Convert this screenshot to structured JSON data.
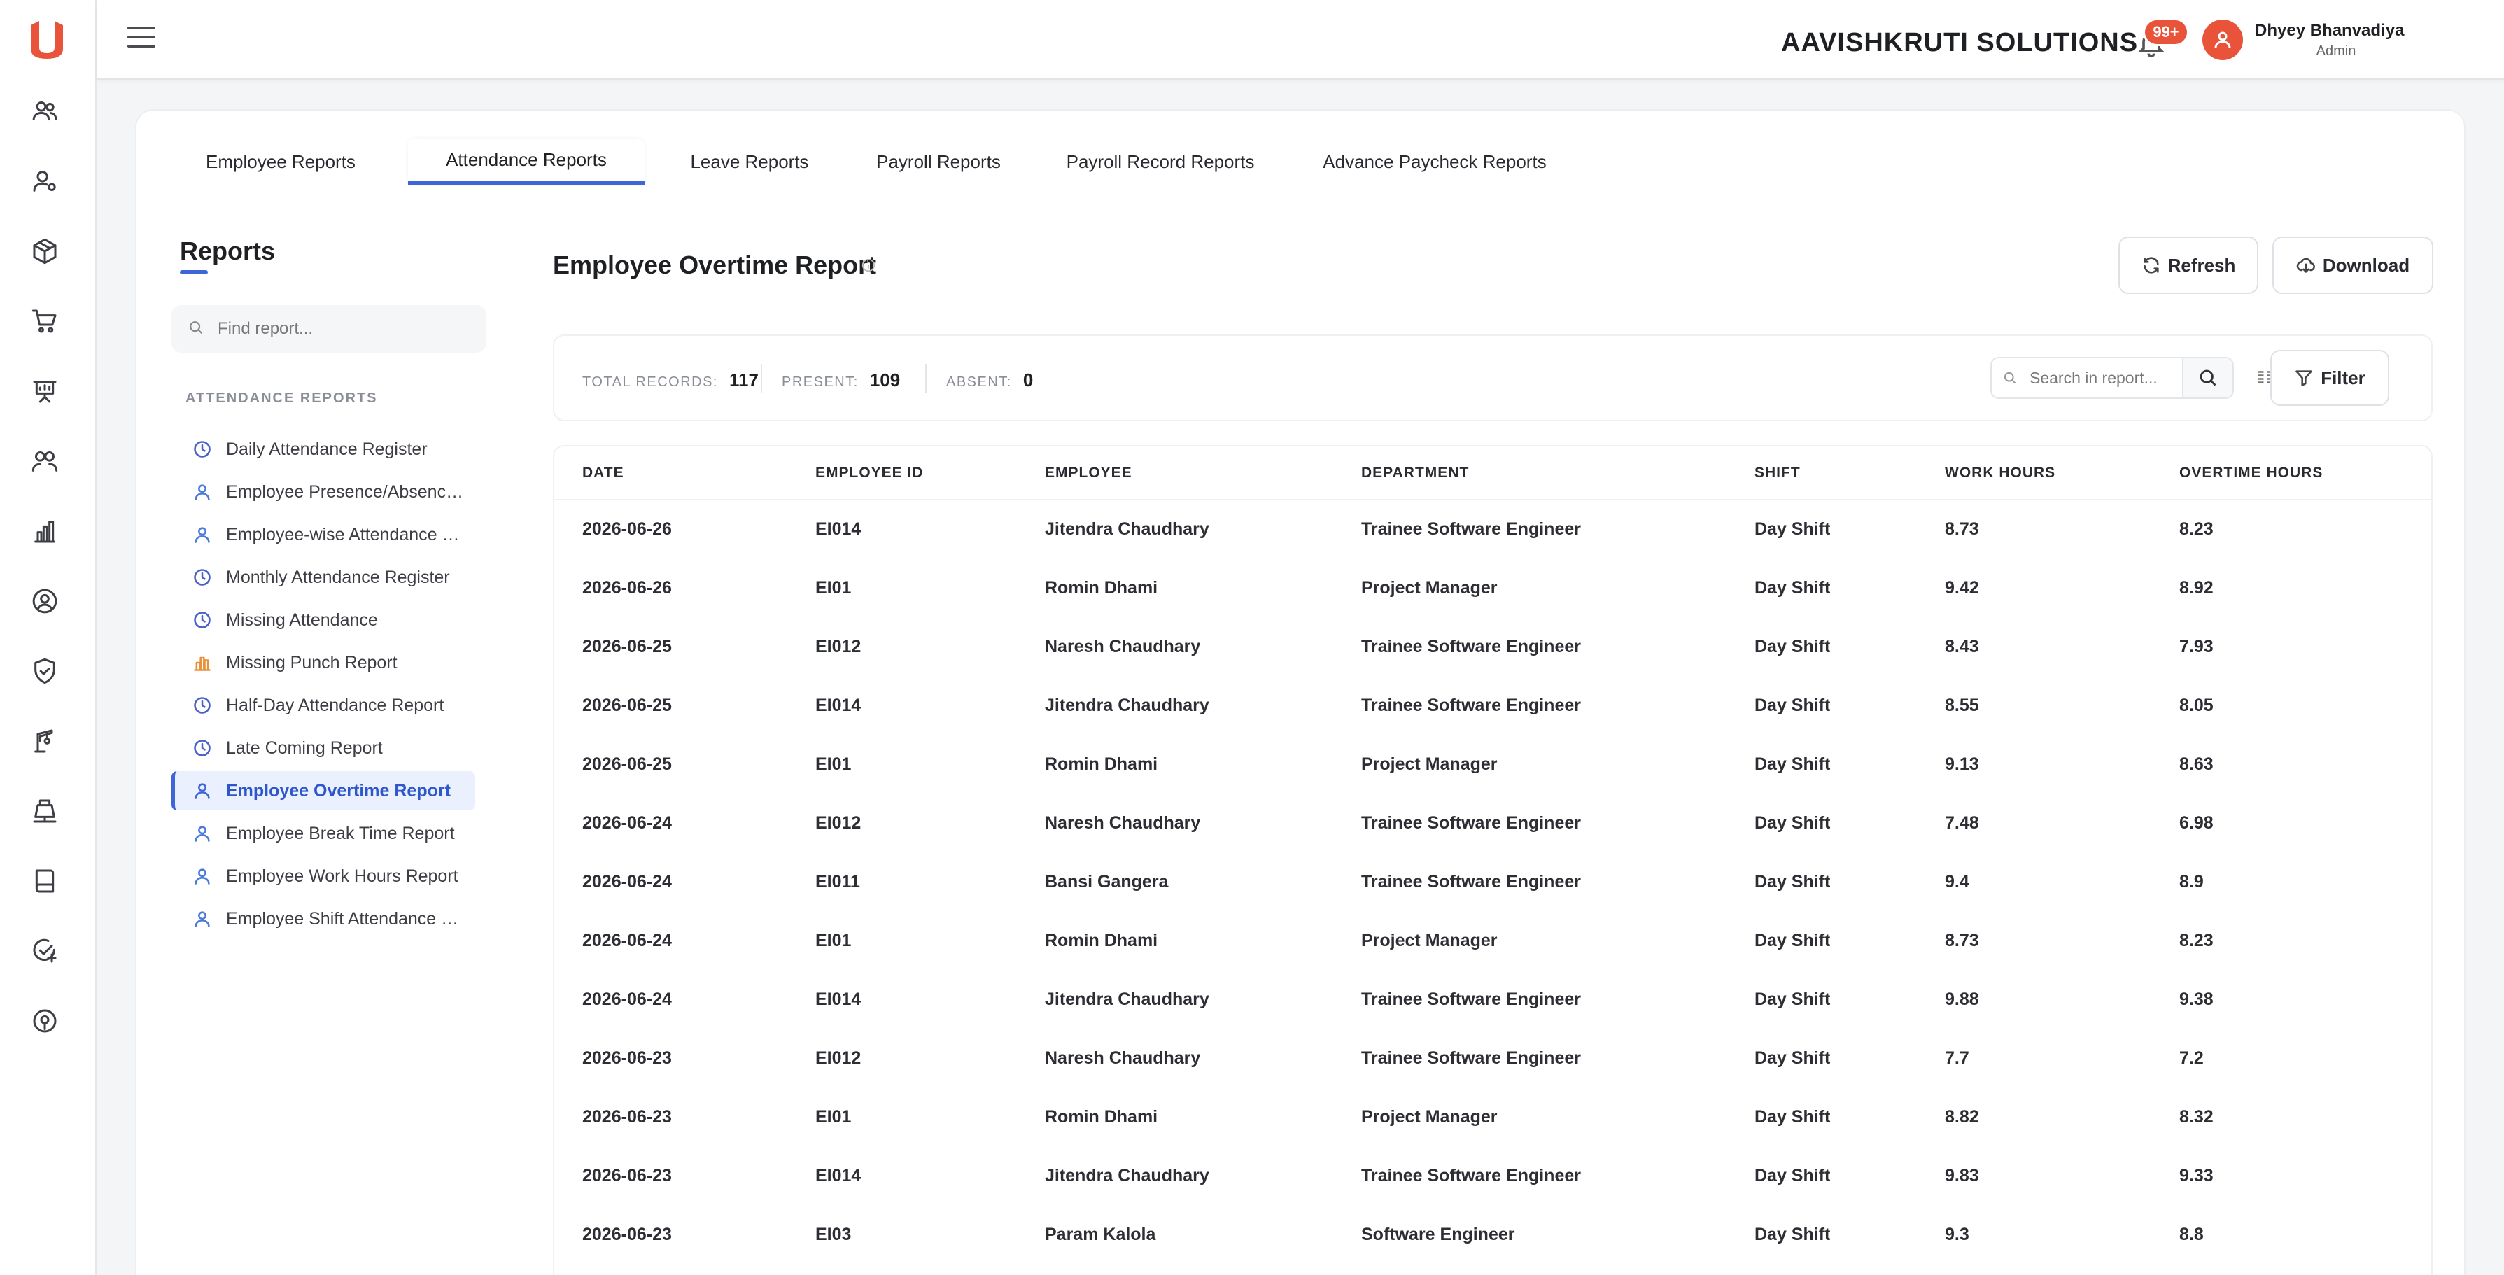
{
  "header": {
    "company": "AAVISHKRUTI SOLUTIONS",
    "notification_count": "99+",
    "user_name": "Dhyey Bhanvadiya",
    "user_role": "Admin"
  },
  "brand_color": "#e8533a",
  "accent_color": "#3f66d8",
  "rail_icons": [
    "users-icon",
    "user-settings-icon",
    "box-icon",
    "cart-icon",
    "presentation-icon",
    "team-icon",
    "bar-chart-icon",
    "user-circle-icon",
    "shield-check-icon",
    "crane-icon",
    "scale-icon",
    "book-icon",
    "check-plus-icon",
    "location-gear-icon"
  ],
  "tabs": [
    {
      "label": "Employee Reports"
    },
    {
      "label": "Attendance Reports"
    },
    {
      "label": "Leave Reports"
    },
    {
      "label": "Payroll Reports"
    },
    {
      "label": "Payroll Record Reports"
    },
    {
      "label": "Advance Paycheck Reports"
    }
  ],
  "sidebar": {
    "title": "Reports",
    "search_placeholder": "Find report...",
    "section_label": "ATTENDANCE REPORTS",
    "items": [
      {
        "label": "Daily Attendance Register",
        "icon": "clock-icon"
      },
      {
        "label": "Employee Presence/Absence Report",
        "icon": "user-icon"
      },
      {
        "label": "Employee-wise Attendance Report",
        "icon": "user-icon"
      },
      {
        "label": "Monthly Attendance Register",
        "icon": "clock-icon"
      },
      {
        "label": "Missing Attendance",
        "icon": "clock-icon"
      },
      {
        "label": "Missing Punch Report",
        "icon": "bar-chart-icon"
      },
      {
        "label": "Half-Day Attendance Report",
        "icon": "clock-icon"
      },
      {
        "label": "Late Coming Report",
        "icon": "clock-icon"
      },
      {
        "label": "Employee Overtime Report",
        "icon": "user-icon"
      },
      {
        "label": "Employee Break Time Report",
        "icon": "user-icon"
      },
      {
        "label": "Employee Work Hours Report",
        "icon": "user-icon"
      },
      {
        "label": "Employee Shift Attendance Report",
        "icon": "user-icon"
      }
    ]
  },
  "report": {
    "title": "Employee Overtime Report",
    "refresh_label": "Refresh",
    "download_label": "Download",
    "filter_label": "Filter",
    "search_placeholder": "Search in report...",
    "stats": {
      "total_label": "TOTAL RECORDS:",
      "total_value": "117",
      "present_label": "PRESENT:",
      "present_value": "109",
      "absent_label": "ABSENT:",
      "absent_value": "0"
    },
    "columns": [
      "DATE",
      "EMPLOYEE ID",
      "EMPLOYEE",
      "DEPARTMENT",
      "SHIFT",
      "WORK HOURS",
      "OVERTIME HOURS"
    ],
    "rows": [
      [
        "2026-06-26",
        "EI014",
        "Jitendra Chaudhary",
        "Trainee Software Engineer",
        "Day Shift",
        "8.73",
        "8.23"
      ],
      [
        "2026-06-26",
        "EI01",
        "Romin Dhami",
        "Project Manager",
        "Day Shift",
        "9.42",
        "8.92"
      ],
      [
        "2026-06-25",
        "EI012",
        "Naresh Chaudhary",
        "Trainee Software Engineer",
        "Day Shift",
        "8.43",
        "7.93"
      ],
      [
        "2026-06-25",
        "EI014",
        "Jitendra Chaudhary",
        "Trainee Software Engineer",
        "Day Shift",
        "8.55",
        "8.05"
      ],
      [
        "2026-06-25",
        "EI01",
        "Romin Dhami",
        "Project Manager",
        "Day Shift",
        "9.13",
        "8.63"
      ],
      [
        "2026-06-24",
        "EI012",
        "Naresh Chaudhary",
        "Trainee Software Engineer",
        "Day Shift",
        "7.48",
        "6.98"
      ],
      [
        "2026-06-24",
        "EI011",
        "Bansi Gangera",
        "Trainee Software Engineer",
        "Day Shift",
        "9.4",
        "8.9"
      ],
      [
        "2026-06-24",
        "EI01",
        "Romin Dhami",
        "Project Manager",
        "Day Shift",
        "8.73",
        "8.23"
      ],
      [
        "2026-06-24",
        "EI014",
        "Jitendra Chaudhary",
        "Trainee Software Engineer",
        "Day Shift",
        "9.88",
        "9.38"
      ],
      [
        "2026-06-23",
        "EI012",
        "Naresh Chaudhary",
        "Trainee Software Engineer",
        "Day Shift",
        "7.7",
        "7.2"
      ],
      [
        "2026-06-23",
        "EI01",
        "Romin Dhami",
        "Project Manager",
        "Day Shift",
        "8.82",
        "8.32"
      ],
      [
        "2026-06-23",
        "EI014",
        "Jitendra Chaudhary",
        "Trainee Software Engineer",
        "Day Shift",
        "9.83",
        "9.33"
      ],
      [
        "2026-06-23",
        "EI03",
        "Param Kalola",
        "Software Engineer",
        "Day Shift",
        "9.3",
        "8.8"
      ]
    ]
  }
}
